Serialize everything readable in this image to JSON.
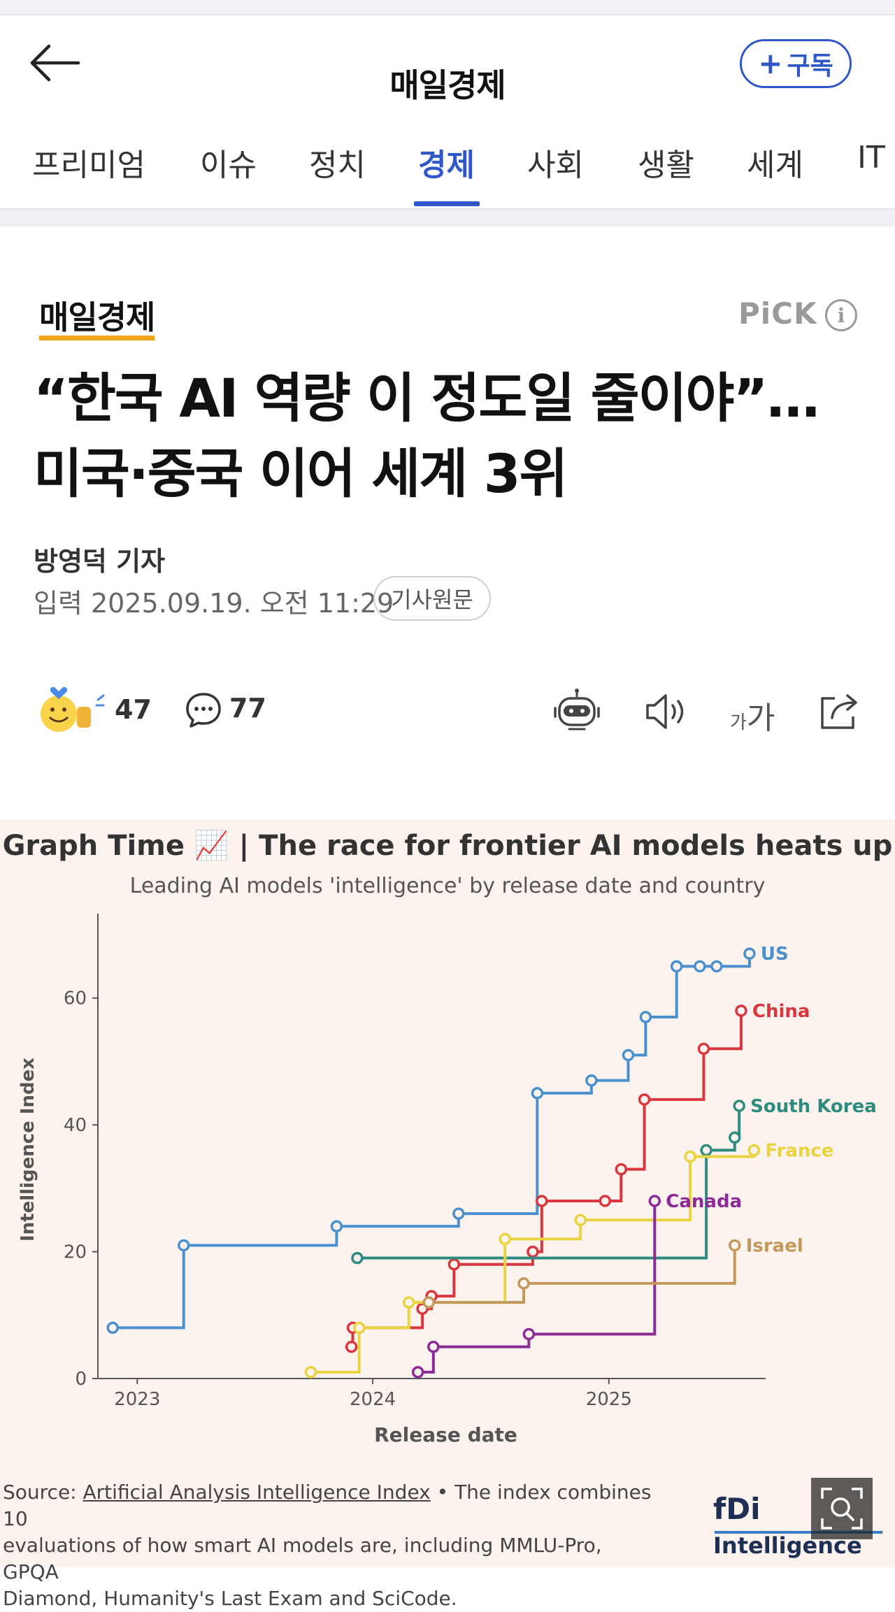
{
  "header": {
    "title": "매일경제",
    "subscribe_label": "구독",
    "subscribe_plus": "+"
  },
  "tabs": [
    "프리미엄",
    "이슈",
    "정치",
    "경제",
    "사회",
    "생활",
    "세계",
    "IT"
  ],
  "active_tab": "경제",
  "article": {
    "press": "매일경제",
    "pick_label": "PiCK",
    "info_label": "i",
    "headline_line1": "“한국 AI 역량 이 정도일 줄이야”…",
    "headline_line2": "미국·중국 이어 세계 3위",
    "reporter": "방영덕 기자",
    "dateline": "입력 2025.09.19. 오전 11:29",
    "origin_label": "기사원문"
  },
  "actions": {
    "reaction_count": "47",
    "comment_count": "77",
    "font_small": "가",
    "font_big": "가"
  },
  "figure": {
    "title": "Graph Time 📈 | The race for frontier AI models heats up",
    "subtitle": "Leading AI models 'intelligence' by release date and country",
    "source_prefix": "Source: ",
    "source_link": "Artificial Analysis Intelligence Index",
    "source_rest_1": " • The index combines 10",
    "source_line2": "evaluations of how smart AI models are, including MMLU-Pro, GPQA",
    "source_line3": "Diamond, Humanity's Last Exam and SciCode.",
    "logo_mark": "fDi",
    "logo_text": "Intelligence"
  },
  "chart_data": {
    "type": "line",
    "step": true,
    "title": "Graph Time 📈 | The race for frontier AI models heats up",
    "subtitle": "Leading AI models 'intelligence' by release date and country",
    "xlabel": "Release date",
    "ylabel": "Intelligence Index",
    "x_ticks": [
      "2023",
      "2024",
      "2025"
    ],
    "y_ticks": [
      "0",
      "20",
      "40",
      "60"
    ],
    "xlim": [
      "2022-11",
      "2025-09"
    ],
    "ylim": [
      0,
      70
    ],
    "grid": false,
    "legend": "labels at line ends",
    "series": [
      {
        "name": "US",
        "color": "#4a90cf",
        "points": [
          [
            "2022-11-24",
            8
          ],
          [
            "2023-03-14",
            21
          ],
          [
            "2023-11-06",
            24
          ],
          [
            "2024-05-13",
            26
          ],
          [
            "2024-09-12",
            45
          ],
          [
            "2024-12-05",
            47
          ],
          [
            "2025-01-31",
            51
          ],
          [
            "2025-02-27",
            57
          ],
          [
            "2025-04-16",
            65
          ],
          [
            "2025-05-22",
            65
          ],
          [
            "2025-06-17",
            65
          ],
          [
            "2025-08-07",
            67
          ]
        ]
      },
      {
        "name": "China",
        "color": "#d9363e",
        "points": [
          [
            "2023-11-29",
            5
          ],
          [
            "2023-12-01",
            8
          ],
          [
            "2024-03-18",
            11
          ],
          [
            "2024-04-01",
            13
          ],
          [
            "2024-05-06",
            18
          ],
          [
            "2024-09-05",
            20
          ],
          [
            "2024-09-19",
            28
          ],
          [
            "2024-12-26",
            28
          ],
          [
            "2025-01-20",
            33
          ],
          [
            "2025-02-25",
            44
          ],
          [
            "2025-05-28",
            52
          ],
          [
            "2025-07-25",
            58
          ]
        ]
      },
      {
        "name": "South Korea",
        "color": "#2e8b80",
        "points": [
          [
            "2023-12-08",
            19
          ],
          [
            "2025-06-01",
            36
          ],
          [
            "2025-07-15",
            38
          ],
          [
            "2025-07-22",
            43
          ]
        ]
      },
      {
        "name": "France",
        "color": "#e9d440",
        "points": [
          [
            "2023-09-27",
            1
          ],
          [
            "2023-12-11",
            8
          ],
          [
            "2024-02-26",
            12
          ],
          [
            "2024-07-24",
            22
          ],
          [
            "2024-11-18",
            25
          ],
          [
            "2025-05-07",
            35
          ],
          [
            "2025-08-14",
            36
          ]
        ]
      },
      {
        "name": "Canada",
        "color": "#8c2a96",
        "points": [
          [
            "2024-03-11",
            1
          ],
          [
            "2024-04-04",
            5
          ],
          [
            "2024-08-30",
            7
          ],
          [
            "2025-03-13",
            28
          ]
        ]
      },
      {
        "name": "Israel",
        "color": "#c4975b",
        "points": [
          [
            "2024-03-28",
            12
          ],
          [
            "2024-08-22",
            15
          ],
          [
            "2025-07-15",
            21
          ]
        ]
      }
    ]
  }
}
